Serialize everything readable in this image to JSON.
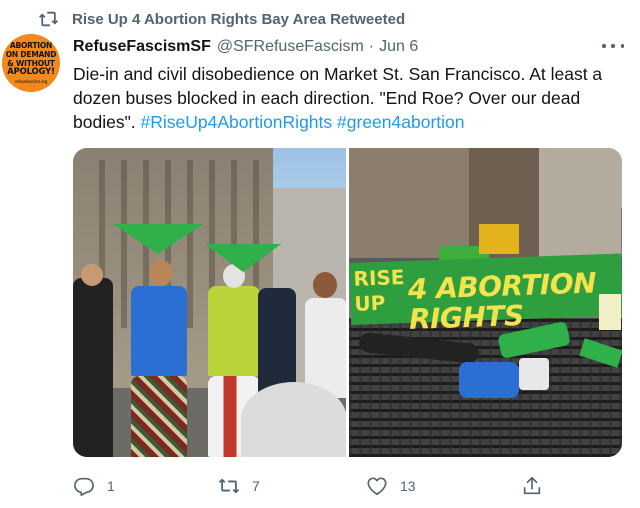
{
  "retweet_banner": {
    "text": "Rise Up 4 Abortion Rights Bay Area Retweeted",
    "icon": "retweet-icon"
  },
  "tweet": {
    "author_name": "RefuseFascismSF",
    "author_handle": "@SFRefuseFascism",
    "separator": "·",
    "date": "Jun 6",
    "avatar_text": [
      "ABORTION",
      "ON DEMAND",
      "& WITHOUT",
      "APOLOGY!",
      "refusefascism.org"
    ],
    "text_parts": [
      {
        "type": "text",
        "value": "Die-in and civil disobedience on Market St. San Francisco.  At least a dozen buses blocked in each direction.  \"End Roe? Over our dead bodies\". "
      },
      {
        "type": "hashtag",
        "value": "#RiseUp4AbortionRights"
      },
      {
        "type": "text",
        "value": " "
      },
      {
        "type": "hashtag",
        "value": "#green4abortion"
      }
    ],
    "banner_text": {
      "line1": "RISE",
      "line2": "UP",
      "line3": "4 ABORTION RIGHTS"
    },
    "media_alt": [
      "Protesters holding green bandanas on Market St.",
      "Die-in protesters lying on street under Rise Up 4 Abortion Rights banner"
    ],
    "actions": {
      "reply": {
        "icon": "reply-icon",
        "count": "1"
      },
      "retweet": {
        "icon": "retweet-icon",
        "count": "7"
      },
      "like": {
        "icon": "heart-icon",
        "count": "13"
      },
      "share": {
        "icon": "share-icon"
      }
    }
  },
  "colors": {
    "accent": "#1d9bf0",
    "muted": "#536471",
    "text": "#0f1419",
    "green": "#2fb04b"
  }
}
